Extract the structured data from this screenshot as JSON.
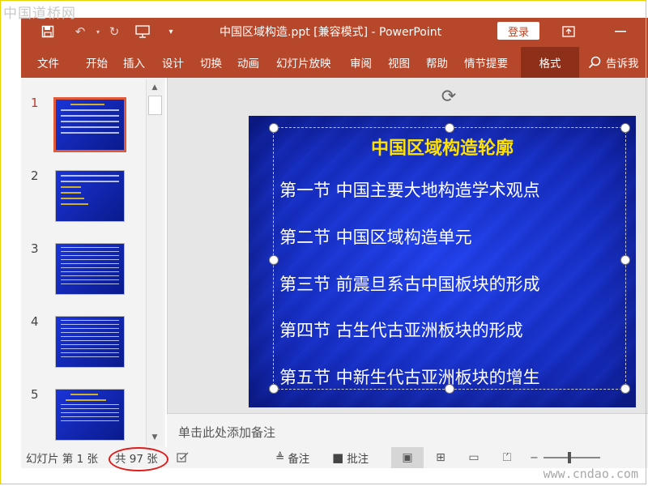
{
  "watermarks": {
    "top_left": "中国道桥网",
    "bottom_right": "www.cndao.com"
  },
  "titlebar": {
    "doc_title": "中国区域构造.ppt [兼容模式] - PowerPoint",
    "login_label": "登录",
    "save_icon": "save-icon",
    "undo_icon": "undo-icon",
    "redo_icon": "redo-icon",
    "present_icon": "present-from-start-icon",
    "customize_icon": "customize-toolbar-icon",
    "restore_icon": "ribbon-display-icon",
    "minimize_icon": "minimize-icon",
    "accent_color": "#b7472a"
  },
  "ribbon": {
    "tabs": [
      "文件",
      "开始",
      "插入",
      "设计",
      "切换",
      "动画",
      "幻灯片放映",
      "审阅",
      "视图",
      "帮助",
      "情节提要",
      "格式"
    ],
    "active_tab": "格式",
    "tell_me": "告诉我"
  },
  "thumbnails": {
    "numbers": [
      "1",
      "2",
      "3",
      "4",
      "5"
    ],
    "selected": "1"
  },
  "slide": {
    "title": "中国区域构造轮廓",
    "items": [
      "第一节  中国主要大地构造学术观点",
      "第二节  中国区域构造单元",
      "第三节  前震旦系古中国板块的形成",
      "第四节  古生代古亚洲板块的形成",
      "第五节  中新生代古亚洲板块的增生"
    ],
    "title_color": "#ffe100",
    "background_color": "#1833e0"
  },
  "notes": {
    "placeholder": "单击此处添加备注"
  },
  "status": {
    "slide_pos": "幻灯片 第 1 张",
    "slide_total": "共 97 张",
    "notes_label": "备注",
    "comments_label": "批注",
    "highlight_color": "#e01b1b"
  }
}
